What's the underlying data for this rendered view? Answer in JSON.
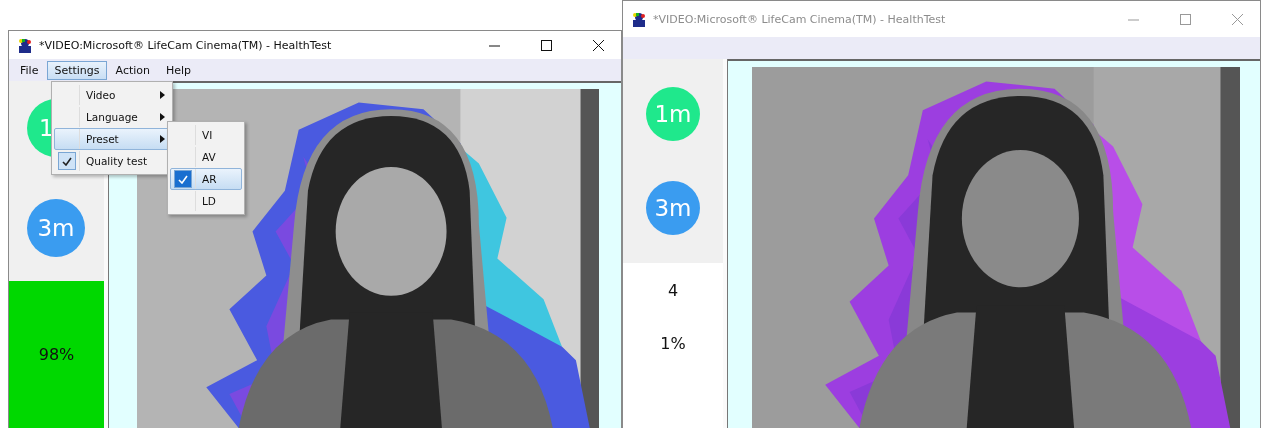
{
  "windows": [
    {
      "title": "*VIDEO:Microsoft® LifeCam Cinema(TM) - HealthTest",
      "active": true,
      "menu": [
        {
          "label": "File",
          "selected": false
        },
        {
          "label": "Settings",
          "selected": true
        },
        {
          "label": "Action",
          "selected": false
        },
        {
          "label": "Help",
          "selected": false
        }
      ],
      "open_menu": [
        {
          "label": "Video",
          "kind": "submenu",
          "checked": false,
          "selected": false
        },
        {
          "label": "Language",
          "kind": "submenu",
          "checked": false,
          "selected": false
        },
        {
          "label": "Preset",
          "kind": "submenu",
          "checked": false,
          "selected": true
        },
        {
          "label": "Quality test",
          "kind": "item",
          "checked": true,
          "selected": false
        }
      ],
      "submenu": [
        {
          "label": "VI",
          "checked": false,
          "selected": false
        },
        {
          "label": "AV",
          "checked": false,
          "selected": false
        },
        {
          "label": "AR",
          "checked": true,
          "selected": true
        },
        {
          "label": "LD",
          "checked": false,
          "selected": false
        }
      ],
      "badges": [
        {
          "label": "1",
          "color": "#1fe88c"
        },
        {
          "label": "3m",
          "color": "#3a9cf0"
        }
      ],
      "result": {
        "passed": true,
        "lines": [
          "98%"
        ]
      }
    },
    {
      "title": "*VIDEO:Microsoft® LifeCam Cinema(TM) - HealthTest",
      "active": false,
      "badges": [
        {
          "label": "1m",
          "color": "#1fe88c"
        },
        {
          "label": "3m",
          "color": "#3a9cf0"
        }
      ],
      "result": {
        "passed": false,
        "lines": [
          "4",
          "1%"
        ]
      }
    }
  ]
}
